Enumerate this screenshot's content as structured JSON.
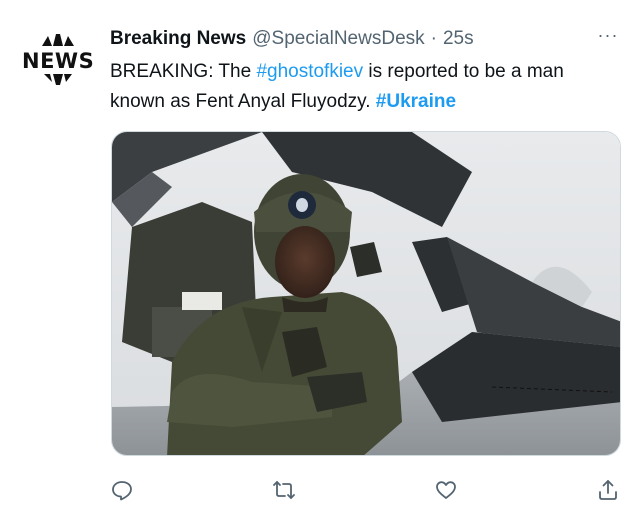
{
  "account": {
    "logo_text": "NEWS",
    "display_name": "Breaking News",
    "handle": "@SpecialNewsDesk",
    "separator": "·",
    "timestamp": "25s"
  },
  "more_icon": "···",
  "tweet": {
    "prefix": "BREAKING: The ",
    "hashtag1": "#ghostofkiev",
    "middle": " is reported to be a man known as Fent Anyal Fluyodzy. ",
    "hashtag2": "#Ukraine"
  },
  "media": {
    "description_icon": "photo-of-pilot-in-jet-cockpit"
  },
  "actions": [
    "reply-icon",
    "retweet-icon",
    "like-icon",
    "share-icon"
  ],
  "colors": {
    "accent": "#1d9bf0",
    "muted": "#536471",
    "text": "#0f1419"
  }
}
